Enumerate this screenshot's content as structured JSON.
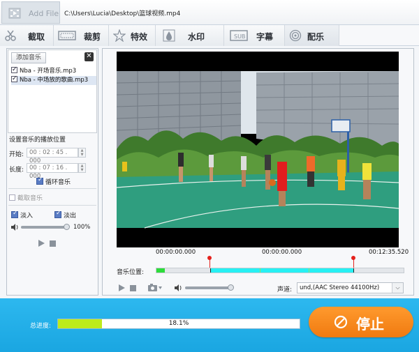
{
  "toolbar": {
    "add_file_label": "Add File",
    "file_path": "C:\\Users\\Lucia\\Desktop\\篮球视频.mp4"
  },
  "tabs": [
    {
      "label": "截取",
      "icon": "clip-icon"
    },
    {
      "label": "裁剪",
      "icon": "crop-icon"
    },
    {
      "label": "特效",
      "icon": "effects-icon"
    },
    {
      "label": "水印",
      "icon": "watermark-icon"
    },
    {
      "label": "字幕",
      "icon": "subtitle-icon"
    },
    {
      "label": "配乐",
      "icon": "music-icon"
    }
  ],
  "music_panel": {
    "add_music_label": "添加音乐",
    "close_label": "✕",
    "tracks": [
      {
        "name": "Nba - 开场音乐.mp3",
        "checked": true
      },
      {
        "name": "Nba - 中场放的歌曲.mp3",
        "checked": true
      }
    ],
    "position_title": "设置音乐的播放位置",
    "start_label": "开始:",
    "start_value": "00 : 02 : 45 . 000",
    "length_label": "长度:",
    "length_value": "00 : 07 : 16 . 000",
    "loop_label": "循环音乐",
    "extract_label": "截取音乐",
    "fade_in_label": "淡入",
    "fade_out_label": "淡出",
    "volume_percent": "100%"
  },
  "player": {
    "time_start": "00:00:00.000",
    "time_current": "00:00:00.000",
    "time_end": "00:12:35.520",
    "music_position_label": "音乐位置:",
    "soundtrack_label": "声道:",
    "soundtrack_value": "und,(AAC Stereo 44100Hz)"
  },
  "bottom": {
    "progress_label": "总进度:",
    "progress_value": 18.1,
    "progress_text": "18.1%",
    "stop_label": "停止"
  },
  "colors": {
    "accent_blue": "#1aa6e1",
    "stop_orange": "#f07a10",
    "progress_green": "#bdeb1c",
    "timeline_cyan": "#27f0f3",
    "marker_red": "#e4211c"
  }
}
